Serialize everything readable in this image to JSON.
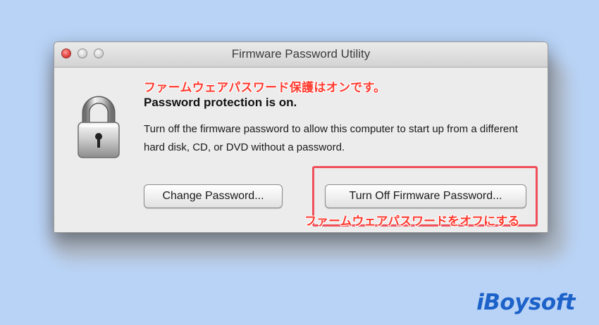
{
  "window": {
    "title": "Firmware Password Utility"
  },
  "annotations": {
    "jp_heading": "ファームウェアパスワード保護はオンです。",
    "jp_button_label": "ファームウェアパスワードをオフにする",
    "highlight_color": "#f0505a",
    "text_color": "#ff3b2f"
  },
  "content": {
    "status_heading": "Password protection is on.",
    "description": "Turn off the firmware password to allow this computer to start up from a different hard disk, CD, or DVD without a password.",
    "icon": "padlock-icon"
  },
  "buttons": {
    "change_password": "Change Password...",
    "turn_off_firmware_password": "Turn Off Firmware Password..."
  },
  "branding": {
    "logo_text": "iBoysoft",
    "logo_color": "#1d62c9"
  },
  "background_color": "#b9d3f6"
}
